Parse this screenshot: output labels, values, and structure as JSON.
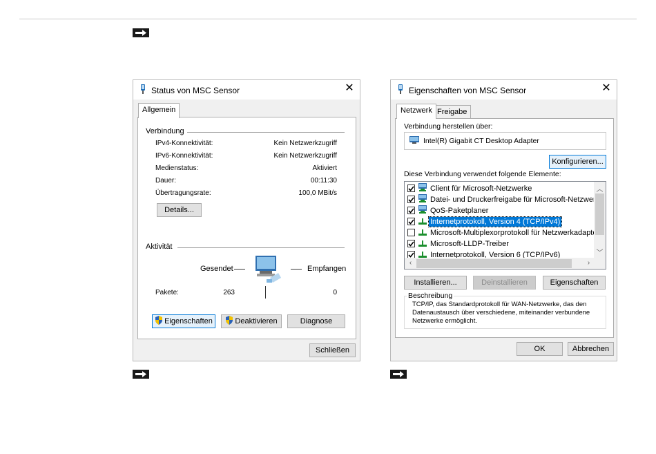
{
  "icons": {
    "arrow": "arrow-right-icon",
    "sensor": "network-sensor-icon",
    "network_adapter": "network-adapter-icon",
    "monitor": "network-computer-icon",
    "shield": "uac-shield-icon",
    "protocol": "protocol-icon"
  },
  "colors": {
    "accent": "#0078d7",
    "rule": "#c8c8c8",
    "dialog_bg": "#f0f0f0"
  },
  "status_dialog": {
    "title": "Status von MSC Sensor",
    "close": "✕",
    "tab": "Allgemein",
    "connection": {
      "heading": "Verbindung",
      "rows": [
        {
          "label": "IPv4-Konnektivität:",
          "value": "Kein Netzwerkzugriff"
        },
        {
          "label": "IPv6-Konnektivität:",
          "value": "Kein Netzwerkzugriff"
        },
        {
          "label": "Medienstatus:",
          "value": "Aktiviert"
        },
        {
          "label": "Dauer:",
          "value": "00:11:30"
        },
        {
          "label": "Übertragungsrate:",
          "value": "100,0 MBit/s"
        }
      ],
      "details_button": "Details..."
    },
    "activity": {
      "heading": "Aktivität",
      "sent_label": "Gesendet",
      "received_label": "Empfangen",
      "packets_label": "Pakete:",
      "packets_sent": "263",
      "packets_received": "0"
    },
    "buttons": {
      "properties": "Eigenschaften",
      "deactivate": "Deaktivieren",
      "diagnose": "Diagnose",
      "close": "Schließen"
    }
  },
  "properties_dialog": {
    "title": "Eigenschaften von MSC Sensor",
    "close": "✕",
    "tabs": [
      "Netzwerk",
      "Freigabe"
    ],
    "connect_using_label": "Verbindung herstellen über:",
    "adapter_name": "Intel(R) Gigabit CT Desktop Adapter",
    "configure_button": "Konfigurieren...",
    "items_label": "Diese Verbindung verwendet folgende Elemente:",
    "items": [
      {
        "label": "Client für Microsoft-Netzwerke",
        "checked": true,
        "icon": "network-computer-icon",
        "selected": false
      },
      {
        "label": "Datei- und Druckerfreigabe für Microsoft-Netzwerke",
        "checked": true,
        "icon": "network-computer-icon",
        "selected": false
      },
      {
        "label": "QoS-Paketplaner",
        "checked": true,
        "icon": "network-computer-icon",
        "selected": false
      },
      {
        "label": "Internetprotokoll, Version 4 (TCP/IPv4)",
        "checked": true,
        "icon": "protocol-icon",
        "selected": true
      },
      {
        "label": "Microsoft-Multiplexorprotokoll für Netzwerkadapter",
        "checked": false,
        "icon": "protocol-icon",
        "selected": false
      },
      {
        "label": "Microsoft-LLDP-Treiber",
        "checked": true,
        "icon": "protocol-icon",
        "selected": false
      },
      {
        "label": "Internetprotokoll, Version 6 (TCP/IPv6)",
        "checked": true,
        "icon": "protocol-icon",
        "selected": false
      }
    ],
    "buttons": {
      "install": "Installieren...",
      "uninstall": "Deinstallieren",
      "properties": "Eigenschaften",
      "ok": "OK",
      "cancel": "Abbrechen"
    },
    "description": {
      "heading": "Beschreibung",
      "text": "TCP/IP, das Standardprotokoll für WAN-Netzwerke, das den Datenaustausch über verschiedene, miteinander verbundene Netzwerke ermöglicht."
    }
  }
}
